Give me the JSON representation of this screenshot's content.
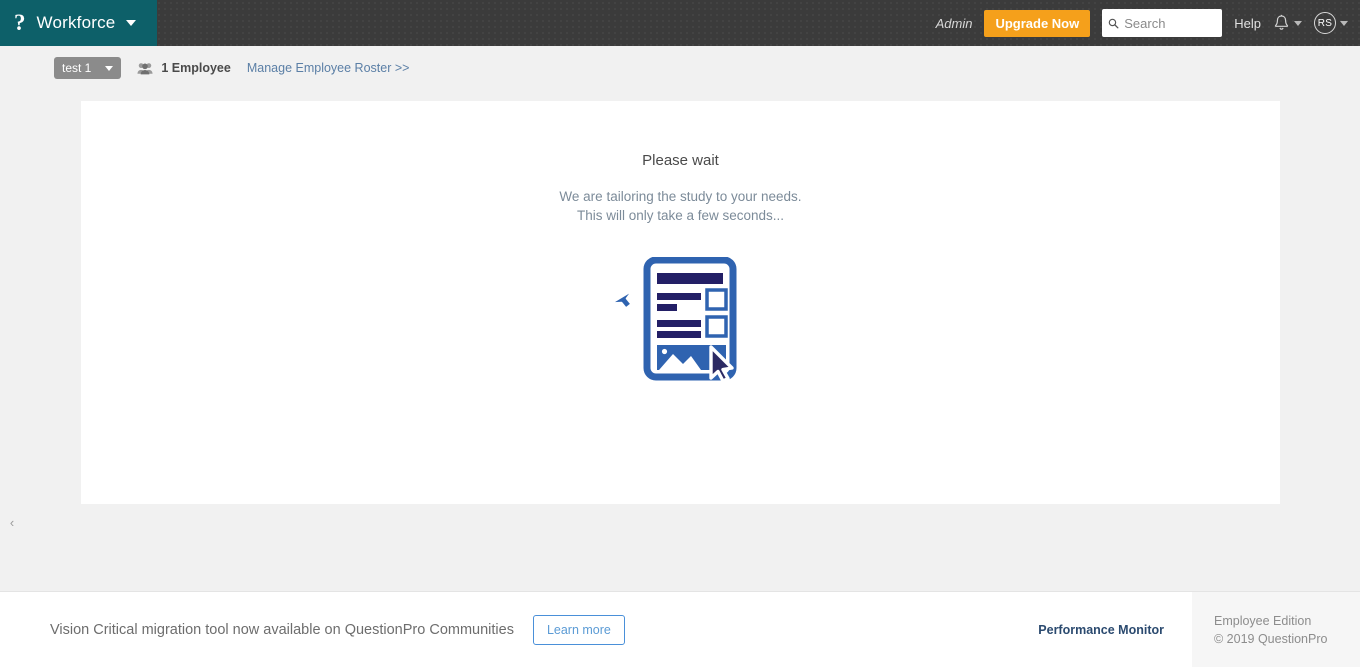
{
  "header": {
    "logo_mark": "?",
    "product_name": "Workforce",
    "admin_label": "Admin",
    "upgrade_label": "Upgrade Now",
    "search_placeholder": "Search",
    "search_value": "",
    "help_label": "Help",
    "avatar_initials": "RS",
    "brand_teal": "#0d6069",
    "bar_dark": "#3b3b3b",
    "upgrade_orange": "#f5a01b"
  },
  "subbar": {
    "project_chip": "test 1",
    "employee_count": "1 Employee",
    "roster_link": "Manage Employee Roster >>"
  },
  "main": {
    "title": "Please wait",
    "subtitle_line1": "We are tailoring the study to your needs.",
    "subtitle_line2": "This will only take a few seconds...",
    "illustration_name": "survey-document-illustration"
  },
  "sidebar": {
    "toggle_glyph": "‹"
  },
  "footer": {
    "promo_text": "Vision Critical migration tool now available on QuestionPro Communities",
    "learn_more_label": "Learn more",
    "performance_monitor_label": "Performance Monitor",
    "edition_label": "Employee Edition",
    "copyright": "© 2019 QuestionPro"
  }
}
